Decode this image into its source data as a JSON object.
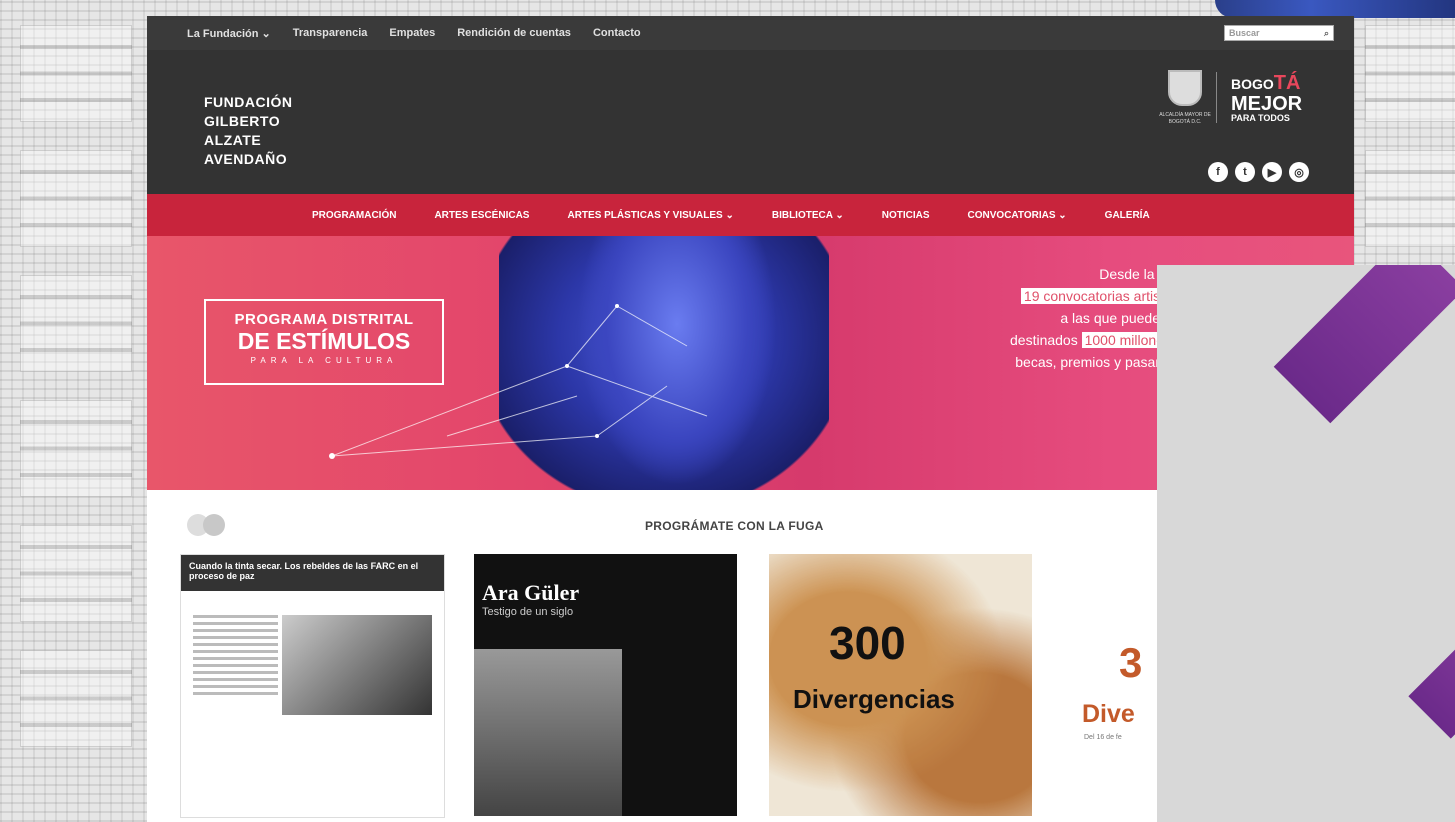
{
  "topbar": {
    "links": [
      "La Fundación ⌄",
      "Transparencia",
      "Empates",
      "Rendición de cuentas",
      "Contacto"
    ],
    "search_placeholder": "Buscar"
  },
  "header": {
    "logo_lines": [
      "FUNDACIÓN",
      "GILBERTO",
      "ALZATE",
      "AVENDAÑO"
    ],
    "crest_text": "ALCALDÍA MAYOR DE BOGOTÁ D.C.",
    "bogota_line1_prefix": "BOGO",
    "bogota_line1_accent": "TÁ",
    "bogota_line2": "MEJOR",
    "bogota_line3": "PARA TODOS",
    "social": [
      "f",
      "t",
      "▶",
      "◎"
    ]
  },
  "nav": {
    "items": [
      "PROGRAMACIÓN",
      "ARTES ESCÉNICAS",
      "ARTES PLÁSTICAS Y VISUALES ⌄",
      "BIBLIOTECA ⌄",
      "NOTICIAS",
      "CONVOCATORIAS ⌄",
      "GALERÍA"
    ]
  },
  "hero": {
    "box_line1": "PROGRAMA DISTRITAL",
    "box_line2": "DE ESTÍMULOS",
    "box_line3": "PARA LA CULTURA",
    "text_line1": "Desde la F",
    "text_line2": "19 convocatorias artist",
    "text_line3": "a las que puedes",
    "text_line4_prefix": "destinados ",
    "text_line4_highlight": "1000 millone",
    "text_line5": "becas, premios y pasant"
  },
  "programate": {
    "title": "PROGRÁMATE CON LA FUGA"
  },
  "cards": {
    "card1_title": "Cuando la tinta secar. Los rebeldes de las FARC en el proceso de paz",
    "card2_title": "Ara Güler",
    "card2_subtitle": "Testigo de un siglo",
    "card3_big": "300",
    "card3_title": "Divergencias",
    "card4_big": "3",
    "card4_title": "Dive",
    "card4_small": "Del 16 de fe"
  },
  "colors": {
    "topbar": "#3a3a3a",
    "header": "#333333",
    "nav": "#c8243c",
    "hero_pink": "#e3466b",
    "overlay_purple": "#6b2a8a"
  }
}
